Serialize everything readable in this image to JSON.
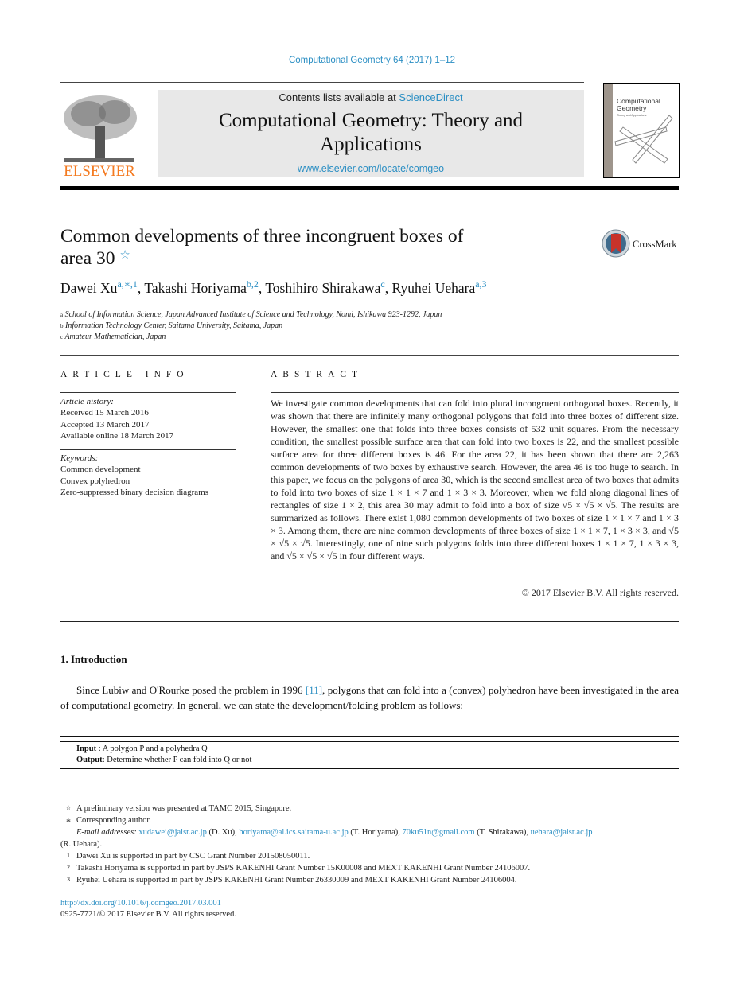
{
  "header": {
    "journal_reference": "Computational Geometry 64 (2017) 1–12",
    "contents_prefix": "Contents lists available at ",
    "contents_link": "ScienceDirect",
    "journal_title": "Computational Geometry: Theory and Applications",
    "journal_url": "www.elsevier.com/locate/comgeo",
    "publisher_logo_text": "ELSEVIER",
    "cover_title": "Computational Geometry",
    "cover_subtitle": "Theory and Applications",
    "brand_color": "#2a8ec3",
    "publisher_color": "#f47a20"
  },
  "article": {
    "title_line1": "Common developments of three incongruent boxes of",
    "title_line2": "area 30",
    "title_note_mark": "☆",
    "crossmark_label": "CrossMark",
    "authors": [
      {
        "name": "Dawei Xu",
        "marks": "a,∗,1",
        "sep": ", "
      },
      {
        "name": "Takashi Horiyama",
        "marks": "b,2",
        "sep": ", "
      },
      {
        "name": "Toshihiro Shirakawa",
        "marks": "c",
        "sep": ", "
      },
      {
        "name": "Ryuhei Uehara",
        "marks": "a,3",
        "sep": ""
      }
    ],
    "affiliations": [
      {
        "mark": "a",
        "text": "School of Information Science, Japan Advanced Institute of Science and Technology, Nomi, Ishikawa 923-1292, Japan"
      },
      {
        "mark": "b",
        "text": "Information Technology Center, Saitama University, Saitama, Japan"
      },
      {
        "mark": "c",
        "text": "Amateur Mathematician, Japan"
      }
    ]
  },
  "article_info": {
    "heading": "ARTICLE INFO",
    "history_label": "Article history:",
    "history": [
      "Received 15 March 2016",
      "Accepted 13 March 2017",
      "Available online 18 March 2017"
    ],
    "keywords_label": "Keywords:",
    "keywords": [
      "Common development",
      "Convex polyhedron",
      "Zero-suppressed binary decision diagrams"
    ]
  },
  "abstract": {
    "heading": "ABSTRACT",
    "text": "We investigate common developments that can fold into plural incongruent orthogonal boxes. Recently, it was shown that there are infinitely many orthogonal polygons that fold into three boxes of different size. However, the smallest one that folds into three boxes consists of 532 unit squares. From the necessary condition, the smallest possible surface area that can fold into two boxes is 22, and the smallest possible surface area for three different boxes is 46. For the area 22, it has been shown that there are 2,263 common developments of two boxes by exhaustive search. However, the area 46 is too huge to search. In this paper, we focus on the polygons of area 30, which is the second smallest area of two boxes that admits to fold into two boxes of size 1 × 1 × 7 and 1 × 3 × 3. Moreover, when we fold along diagonal lines of rectangles of size 1 × 2, this area 30 may admit to fold into a box of size √5 × √5 × √5. The results are summarized as follows. There exist 1,080 common developments of two boxes of size 1 × 1 × 7 and 1 × 3 × 3. Among them, there are nine common developments of three boxes of size 1 × 1 × 7, 1 × 3 × 3, and √5 × √5 × √5. Interestingly, one of nine such polygons folds into three different boxes 1 × 1 × 7, 1 × 3 × 3, and √5 × √5 × √5 in four different ways.",
    "copyright": "© 2017 Elsevier B.V. All rights reserved."
  },
  "introduction": {
    "heading": "1. Introduction",
    "text_before_ref": "Since Lubiw and O'Rourke posed the problem in 1996 ",
    "ref": "[11]",
    "text_after_ref": ", polygons that can fold into a (convex) polyhedron have been investigated in the area of computational geometry. In general, we can state the development/folding problem as follows:",
    "problem": {
      "input_label": "Input",
      "input_text": " : A polygon P and a polyhedra Q",
      "output_label": "Output",
      "output_text": ": Determine whether P can fold into Q or not"
    }
  },
  "footnotes": {
    "star_note": {
      "mark": "☆",
      "text": "A preliminary version was presented at TAMC 2015, Singapore."
    },
    "corresponding": {
      "mark": "*",
      "text": "Corresponding author."
    },
    "email_label": "E-mail addresses: ",
    "emails": [
      {
        "email": "xudawei@jaist.ac.jp",
        "who": " (D. Xu), "
      },
      {
        "email": "horiyama@al.ics.saitama-u.ac.jp",
        "who": " (T. Horiyama), "
      },
      {
        "email": "70ku51n@gmail.com",
        "who": " (T. Shirakawa), "
      },
      {
        "email": "uehara@jaist.ac.jp",
        "who": ""
      }
    ],
    "email_tail": "(R. Uehara).",
    "grants": [
      {
        "mark": "1",
        "text": "Dawei Xu is supported in part by CSC Grant Number 201508050011."
      },
      {
        "mark": "2",
        "text": "Takashi Horiyama is supported in part by JSPS KAKENHI Grant Number 15K00008 and MEXT KAKENHI Grant Number 24106007."
      },
      {
        "mark": "3",
        "text": "Ryuhei Uehara is supported in part by JSPS KAKENHI Grant Number 26330009 and MEXT KAKENHI Grant Number 24106004."
      }
    ],
    "doi": "http://dx.doi.org/10.1016/j.comgeo.2017.03.001",
    "issn": "0925-7721/© 2017 Elsevier B.V. All rights reserved."
  }
}
